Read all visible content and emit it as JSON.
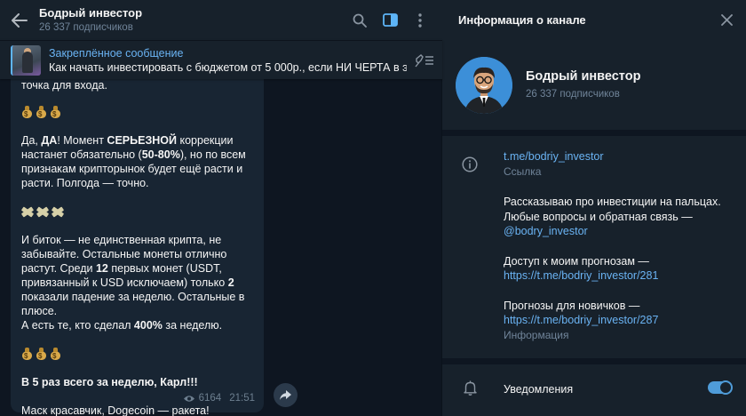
{
  "chat": {
    "title": "Бодрый инвестор",
    "subscribers": "26 337 подписчиков"
  },
  "pinned": {
    "title": "Закреплённое сообщение",
    "text": "Как начать инвестировать с бюджетом от 5 000р., если НИ ЧЕРТА в э..."
  },
  "message": {
    "line_top": "точка для входа.",
    "p1_a": "Да, ",
    "p1_b": "ДА",
    "p1_c": "! Момент ",
    "p1_d": "СЕРЬЕЗНОЙ",
    "p1_e": " коррекции настанет обязательно (",
    "p1_f": "50-80%",
    "p1_g": "), но по всем признакам крипторынок будет ещё расти и расти. Полгода — точно.",
    "p2_a": "И биток — не единственная крипта, не забывайте. Остальные монеты отлично растут. Среди ",
    "p2_b": "12",
    "p2_c": " первых монет (USDT, привязанный к USD исключаем) только ",
    "p2_d": "2",
    "p2_e": " показали падение за неделю. Остальные в плюсе.",
    "p2_f": "А есть те, кто сделал ",
    "p2_g": "400%",
    "p2_h": " за неделю.",
    "p3": "В 5 раз всего за неделю, Карл!!!",
    "p4": "Маск красавчик, Dogecoin — ракета!",
    "views": "6164",
    "time": "21:51"
  },
  "info": {
    "header": "Информация о канале",
    "name": "Бодрый инвестор",
    "subscribers": "26 337 подписчиков",
    "link": "t.me/bodriy_investor",
    "link_caption": "Ссылка",
    "desc1": "Рассказываю про инвестиции на пальцах. Любые вопросы и обратная связь —",
    "desc_handle": "@bodry_investor",
    "desc2": "Доступ к моим прогнозам —",
    "desc2_link": "https://t.me/bodriy_investor/281",
    "desc3": "Прогнозы для новичков —",
    "desc3_link": "https://t.me/bodriy_investor/287",
    "desc_caption": "Информация",
    "notifications": "Уведомления",
    "notifications_on": true
  },
  "icons": {
    "back": "arrow-left-icon",
    "search": "search-icon",
    "sidebar": "sidebar-toggle-icon",
    "more": "more-vertical-icon",
    "unpin": "unpin-icon",
    "share": "share-icon",
    "eye": "eye-icon",
    "close": "close-icon",
    "info": "info-icon",
    "bell": "bell-icon"
  },
  "colors": {
    "accent": "#5eb5f7",
    "link": "#6ab3f3",
    "bg": "#0e1621",
    "panel": "#17212b",
    "bubble": "#182533"
  }
}
